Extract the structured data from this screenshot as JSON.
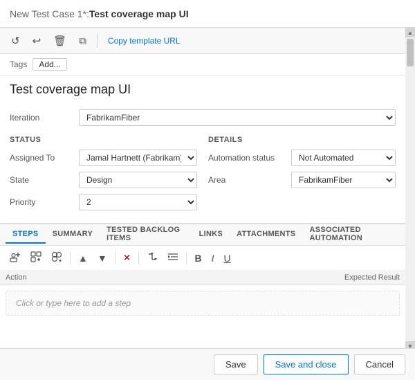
{
  "titleBar": {
    "prefix": "New Test Case 1*: ",
    "main": "Test coverage map UI"
  },
  "toolbar": {
    "icons": [
      "↺",
      "↩",
      "🗑",
      "⧉"
    ],
    "copyUrl": "Copy template URL"
  },
  "tags": {
    "label": "Tags",
    "addButton": "Add..."
  },
  "workItemTitle": "Test coverage map UI",
  "iteration": {
    "label": "Iteration",
    "value": "FabrikamFiber"
  },
  "statusSection": {
    "header": "STATUS",
    "fields": {
      "assignedTo": {
        "label": "Assigned To",
        "value": "Jamal Hartnett (Fabrikam)"
      },
      "state": {
        "label": "State",
        "value": "Design"
      },
      "priority": {
        "label": "Priority",
        "value": "2"
      }
    }
  },
  "detailsSection": {
    "header": "DETAILS",
    "fields": {
      "automationStatus": {
        "label": "Automation status",
        "value": "Not Automated"
      },
      "area": {
        "label": "Area",
        "value": "FabrikamFiber"
      }
    }
  },
  "tabs": [
    {
      "label": "STEPS",
      "active": true
    },
    {
      "label": "SUMMARY",
      "active": false
    },
    {
      "label": "TESTED BACKLOG ITEMS",
      "active": false
    },
    {
      "label": "LINKS",
      "active": false
    },
    {
      "label": "ATTACHMENTS",
      "active": false
    },
    {
      "label": "ASSOCIATED AUTOMATION",
      "active": false
    }
  ],
  "stepsToolbar": {
    "buttons": [
      "add-step",
      "add-shared",
      "add-shared-steps",
      "move-up",
      "move-down",
      "delete",
      "insert",
      "indent",
      "bold",
      "italic",
      "underline"
    ]
  },
  "stepsTable": {
    "actionHeader": "Action",
    "resultHeader": "Expected Result",
    "placeholder": "Click or type here to add a step"
  },
  "bottomButtons": {
    "save": "Save",
    "saveAndClose": "Save and close",
    "cancel": "Cancel"
  }
}
